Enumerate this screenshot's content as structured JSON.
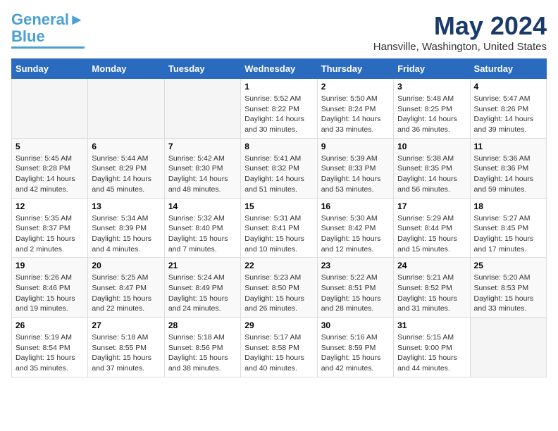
{
  "logo": {
    "line1": "General",
    "line2": "Blue"
  },
  "title": "May 2024",
  "location": "Hansville, Washington, United States",
  "days_of_week": [
    "Sunday",
    "Monday",
    "Tuesday",
    "Wednesday",
    "Thursday",
    "Friday",
    "Saturday"
  ],
  "weeks": [
    [
      {
        "day": "",
        "empty": true
      },
      {
        "day": "",
        "empty": true
      },
      {
        "day": "",
        "empty": true
      },
      {
        "day": "1",
        "sunrise": "Sunrise: 5:52 AM",
        "sunset": "Sunset: 8:22 PM",
        "daylight": "Daylight: 14 hours and 30 minutes."
      },
      {
        "day": "2",
        "sunrise": "Sunrise: 5:50 AM",
        "sunset": "Sunset: 8:24 PM",
        "daylight": "Daylight: 14 hours and 33 minutes."
      },
      {
        "day": "3",
        "sunrise": "Sunrise: 5:48 AM",
        "sunset": "Sunset: 8:25 PM",
        "daylight": "Daylight: 14 hours and 36 minutes."
      },
      {
        "day": "4",
        "sunrise": "Sunrise: 5:47 AM",
        "sunset": "Sunset: 8:26 PM",
        "daylight": "Daylight: 14 hours and 39 minutes."
      }
    ],
    [
      {
        "day": "5",
        "sunrise": "Sunrise: 5:45 AM",
        "sunset": "Sunset: 8:28 PM",
        "daylight": "Daylight: 14 hours and 42 minutes."
      },
      {
        "day": "6",
        "sunrise": "Sunrise: 5:44 AM",
        "sunset": "Sunset: 8:29 PM",
        "daylight": "Daylight: 14 hours and 45 minutes."
      },
      {
        "day": "7",
        "sunrise": "Sunrise: 5:42 AM",
        "sunset": "Sunset: 8:30 PM",
        "daylight": "Daylight: 14 hours and 48 minutes."
      },
      {
        "day": "8",
        "sunrise": "Sunrise: 5:41 AM",
        "sunset": "Sunset: 8:32 PM",
        "daylight": "Daylight: 14 hours and 51 minutes."
      },
      {
        "day": "9",
        "sunrise": "Sunrise: 5:39 AM",
        "sunset": "Sunset: 8:33 PM",
        "daylight": "Daylight: 14 hours and 53 minutes."
      },
      {
        "day": "10",
        "sunrise": "Sunrise: 5:38 AM",
        "sunset": "Sunset: 8:35 PM",
        "daylight": "Daylight: 14 hours and 56 minutes."
      },
      {
        "day": "11",
        "sunrise": "Sunrise: 5:36 AM",
        "sunset": "Sunset: 8:36 PM",
        "daylight": "Daylight: 14 hours and 59 minutes."
      }
    ],
    [
      {
        "day": "12",
        "sunrise": "Sunrise: 5:35 AM",
        "sunset": "Sunset: 8:37 PM",
        "daylight": "Daylight: 15 hours and 2 minutes."
      },
      {
        "day": "13",
        "sunrise": "Sunrise: 5:34 AM",
        "sunset": "Sunset: 8:39 PM",
        "daylight": "Daylight: 15 hours and 4 minutes."
      },
      {
        "day": "14",
        "sunrise": "Sunrise: 5:32 AM",
        "sunset": "Sunset: 8:40 PM",
        "daylight": "Daylight: 15 hours and 7 minutes."
      },
      {
        "day": "15",
        "sunrise": "Sunrise: 5:31 AM",
        "sunset": "Sunset: 8:41 PM",
        "daylight": "Daylight: 15 hours and 10 minutes."
      },
      {
        "day": "16",
        "sunrise": "Sunrise: 5:30 AM",
        "sunset": "Sunset: 8:42 PM",
        "daylight": "Daylight: 15 hours and 12 minutes."
      },
      {
        "day": "17",
        "sunrise": "Sunrise: 5:29 AM",
        "sunset": "Sunset: 8:44 PM",
        "daylight": "Daylight: 15 hours and 15 minutes."
      },
      {
        "day": "18",
        "sunrise": "Sunrise: 5:27 AM",
        "sunset": "Sunset: 8:45 PM",
        "daylight": "Daylight: 15 hours and 17 minutes."
      }
    ],
    [
      {
        "day": "19",
        "sunrise": "Sunrise: 5:26 AM",
        "sunset": "Sunset: 8:46 PM",
        "daylight": "Daylight: 15 hours and 19 minutes."
      },
      {
        "day": "20",
        "sunrise": "Sunrise: 5:25 AM",
        "sunset": "Sunset: 8:47 PM",
        "daylight": "Daylight: 15 hours and 22 minutes."
      },
      {
        "day": "21",
        "sunrise": "Sunrise: 5:24 AM",
        "sunset": "Sunset: 8:49 PM",
        "daylight": "Daylight: 15 hours and 24 minutes."
      },
      {
        "day": "22",
        "sunrise": "Sunrise: 5:23 AM",
        "sunset": "Sunset: 8:50 PM",
        "daylight": "Daylight: 15 hours and 26 minutes."
      },
      {
        "day": "23",
        "sunrise": "Sunrise: 5:22 AM",
        "sunset": "Sunset: 8:51 PM",
        "daylight": "Daylight: 15 hours and 28 minutes."
      },
      {
        "day": "24",
        "sunrise": "Sunrise: 5:21 AM",
        "sunset": "Sunset: 8:52 PM",
        "daylight": "Daylight: 15 hours and 31 minutes."
      },
      {
        "day": "25",
        "sunrise": "Sunrise: 5:20 AM",
        "sunset": "Sunset: 8:53 PM",
        "daylight": "Daylight: 15 hours and 33 minutes."
      }
    ],
    [
      {
        "day": "26",
        "sunrise": "Sunrise: 5:19 AM",
        "sunset": "Sunset: 8:54 PM",
        "daylight": "Daylight: 15 hours and 35 minutes."
      },
      {
        "day": "27",
        "sunrise": "Sunrise: 5:18 AM",
        "sunset": "Sunset: 8:55 PM",
        "daylight": "Daylight: 15 hours and 37 minutes."
      },
      {
        "day": "28",
        "sunrise": "Sunrise: 5:18 AM",
        "sunset": "Sunset: 8:56 PM",
        "daylight": "Daylight: 15 hours and 38 minutes."
      },
      {
        "day": "29",
        "sunrise": "Sunrise: 5:17 AM",
        "sunset": "Sunset: 8:58 PM",
        "daylight": "Daylight: 15 hours and 40 minutes."
      },
      {
        "day": "30",
        "sunrise": "Sunrise: 5:16 AM",
        "sunset": "Sunset: 8:59 PM",
        "daylight": "Daylight: 15 hours and 42 minutes."
      },
      {
        "day": "31",
        "sunrise": "Sunrise: 5:15 AM",
        "sunset": "Sunset: 9:00 PM",
        "daylight": "Daylight: 15 hours and 44 minutes."
      },
      {
        "day": "",
        "empty": true
      }
    ]
  ]
}
